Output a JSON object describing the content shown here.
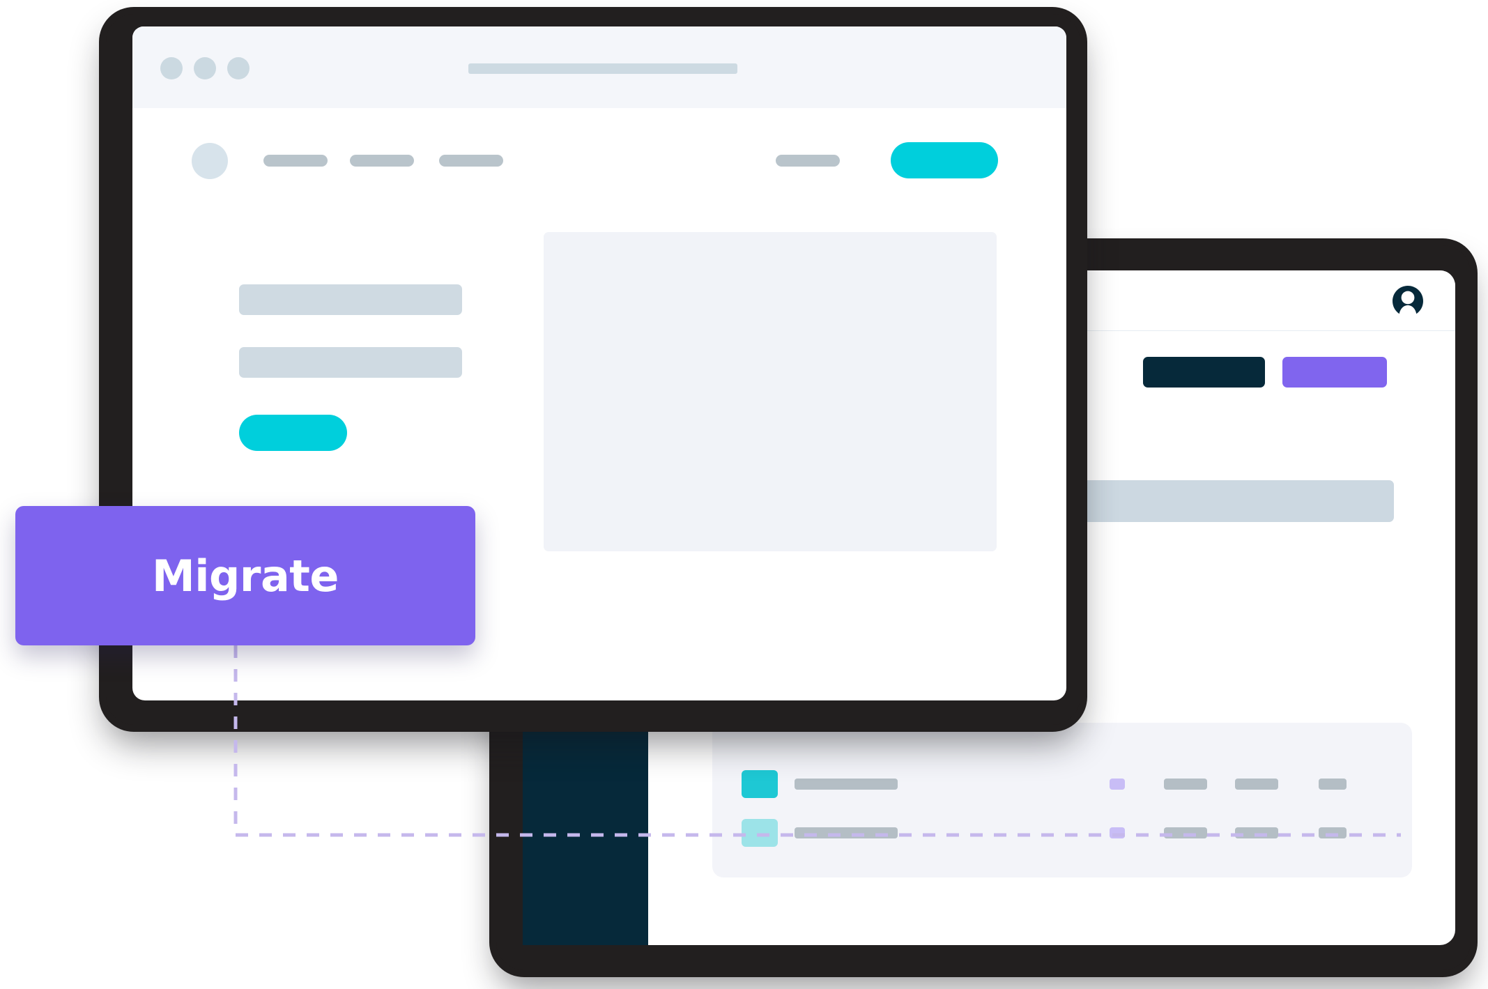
{
  "callout": {
    "label": "Migrate",
    "bg_color": "#7E63EE",
    "text_color": "#FFFFFF",
    "connector_color": "#C5B8EC",
    "connector_style": "dashed"
  },
  "palette": {
    "teal": "#00CFDC",
    "teal_chip_solid": "#1EC8D4",
    "teal_chip_light": "#9CE3E8",
    "purple": "#8065EE",
    "purple_chip": "#C8BDF6",
    "navy": "#06293A",
    "placeholder_blue": "#CFDAE2",
    "placeholder_gray": "#B4BEC5",
    "table_header": "#CCD8E1",
    "card_bg": "#F3F4F9",
    "chrome_bg": "#F4F6FA",
    "media_bg": "#F1F3F8",
    "frame_dark": "#221F1F"
  },
  "window_front": {
    "name": "browser-window",
    "chrome": {
      "traffic_lights": [
        "close-dot",
        "minimize-dot",
        "maximize-dot"
      ],
      "url_placeholder": ""
    },
    "nav": {
      "logo": "logo-mark",
      "links": [
        "",
        "",
        ""
      ],
      "secondary_link": "",
      "cta_label": ""
    },
    "hero": {
      "heading_placeholder": "",
      "subheading_placeholder": "",
      "cta_label": "",
      "media_placeholder": ""
    }
  },
  "window_back": {
    "name": "app-window",
    "topbar": {
      "avatar": "user-avatar-icon"
    },
    "actions": [
      {
        "label": "",
        "variant": "dark"
      },
      {
        "label": "",
        "variant": "purple"
      }
    ],
    "table": {
      "header_placeholder": "",
      "columns": [
        "status",
        "col-1",
        "col-2",
        "col-3"
      ],
      "rows": [
        {
          "status": "",
          "cells": [
            "",
            "",
            ""
          ]
        },
        {
          "status": "",
          "cells": [
            "",
            "",
            ""
          ]
        },
        {
          "status": "",
          "cells": [
            "",
            "",
            ""
          ]
        }
      ]
    },
    "bottom_card": {
      "rows": [
        {
          "swatch": "teal-solid",
          "label": "",
          "status": "",
          "cells": [
            "",
            "",
            ""
          ]
        },
        {
          "swatch": "teal-light",
          "label": "",
          "status": "",
          "cells": [
            "",
            "",
            ""
          ]
        }
      ]
    },
    "sidebar": {
      "color": "#06293A"
    }
  }
}
